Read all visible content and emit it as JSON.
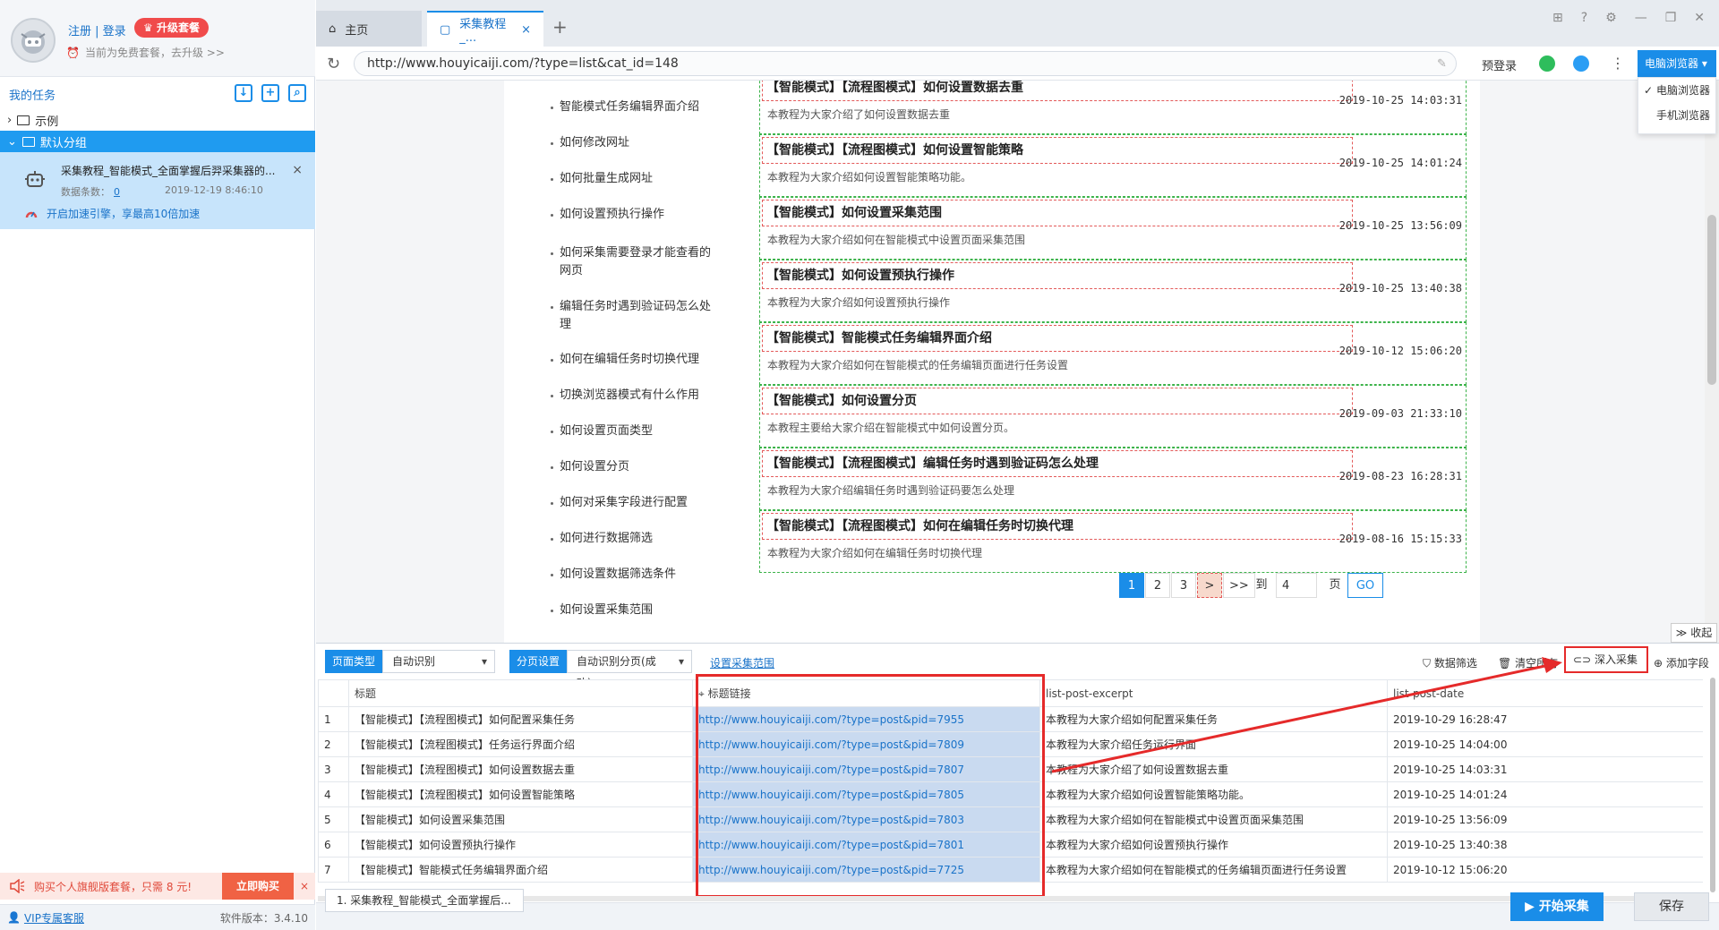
{
  "sidebar": {
    "login_link": "注册 | 登录",
    "upgrade_button": "升级套餐",
    "plan_text": "当前为免费套餐，去升级 >>",
    "my_tasks": "我的任务",
    "groups": [
      {
        "label": "示例"
      },
      {
        "label": "默认分组"
      }
    ],
    "task": {
      "title": "采集教程_智能模式_全面掌握后羿采集器的...",
      "count_label": "数据条数：",
      "count": "0",
      "time": "2019-12-19 8:46:10",
      "accel_text": "开启加速引擎，享最高10倍加速"
    },
    "promo": {
      "text": "购买个人旗舰版套餐，只需 8 元!",
      "buy": "立即购买"
    },
    "footer": {
      "vip": "VIP专属客服",
      "version": "软件版本：3.4.10"
    }
  },
  "browser": {
    "tabs": [
      {
        "label": "主页"
      },
      {
        "label": "采集教程_..."
      }
    ],
    "url": "http://www.houyicaiji.com/?type=list&cat_id=148",
    "prelogin": "预登录",
    "mode_button": "电脑浏览器",
    "mode_options": [
      "电脑浏览器",
      "手机浏览器"
    ]
  },
  "page": {
    "nav_items": [
      "智能模式任务编辑界面介绍",
      "如何修改网址",
      "如何批量生成网址",
      "如何设置预执行操作",
      "如何采集需要登录才能查看的网页",
      "编辑任务时遇到验证码怎么处理",
      "如何在编辑任务时切换代理",
      "切换浏览器模式有什么作用",
      "如何设置页面类型",
      "如何设置分页",
      "如何对采集字段进行配置",
      "如何进行数据筛选",
      "如何设置数据筛选条件",
      "如何设置采集范围"
    ],
    "posts": [
      {
        "title": "【智能模式】【流程图模式】如何设置数据去重",
        "date": "2019-10-25 14:03:31",
        "excerpt": "本教程为大家介绍了如何设置数据去重"
      },
      {
        "title": "【智能模式】【流程图模式】如何设置智能策略",
        "date": "2019-10-25 14:01:24",
        "excerpt": "本教程为大家介绍如何设置智能策略功能。"
      },
      {
        "title": "【智能模式】如何设置采集范围",
        "date": "2019-10-25 13:56:09",
        "excerpt": "本教程为大家介绍如何在智能模式中设置页面采集范围"
      },
      {
        "title": "【智能模式】如何设置预执行操作",
        "date": "2019-10-25 13:40:38",
        "excerpt": "本教程为大家介绍如何设置预执行操作"
      },
      {
        "title": "【智能模式】智能模式任务编辑界面介绍",
        "date": "2019-10-12 15:06:20",
        "excerpt": "本教程为大家介绍如何在智能模式的任务编辑页面进行任务设置"
      },
      {
        "title": "【智能模式】如何设置分页",
        "date": "2019-09-03 21:33:10",
        "excerpt": "本教程主要给大家介绍在智能模式中如何设置分页。"
      },
      {
        "title": "【智能模式】【流程图模式】编辑任务时遇到验证码怎么处理",
        "date": "2019-08-23 16:28:31",
        "excerpt": "本教程为大家介绍编辑任务时遇到验证码要怎么处理"
      },
      {
        "title": "【智能模式】【流程图模式】如何在编辑任务时切换代理",
        "date": "2019-08-16 15:15:33",
        "excerpt": "本教程为大家介绍如何在编辑任务时切换代理"
      }
    ],
    "pager": {
      "pages": [
        "1",
        "2",
        "3"
      ],
      "next": ">",
      "last": ">>",
      "goto_label": "到",
      "goto_value": "4",
      "page_unit": "页",
      "go": "GO"
    },
    "collapse": "收起"
  },
  "panel": {
    "page_type_label": "页面类型",
    "page_type_value": "自动识别",
    "paging_label": "分页设置",
    "paging_value": "自动识别分页(成功)",
    "scope_link": "设置采集范围",
    "tools": {
      "filter": "数据筛选",
      "clear": "清空所有",
      "deep": "深入采集",
      "add_field": "添加字段"
    },
    "columns": [
      "标题",
      "标题链接",
      "list-post-excerpt",
      "list-post-date"
    ],
    "rows": [
      [
        "1",
        "【智能模式】【流程图模式】如何配置采集任务",
        "http://www.houyicaiji.com/?type=post&pid=7955",
        "本教程为大家介绍如何配置采集任务",
        "2019-10-29 16:28:47"
      ],
      [
        "2",
        "【智能模式】【流程图模式】任务运行界面介绍",
        "http://www.houyicaiji.com/?type=post&pid=7809",
        "本教程为大家介绍任务运行界面",
        "2019-10-25 14:04:00"
      ],
      [
        "3",
        "【智能模式】【流程图模式】如何设置数据去重",
        "http://www.houyicaiji.com/?type=post&pid=7807",
        "本教程为大家介绍了如何设置数据去重",
        "2019-10-25 14:03:31"
      ],
      [
        "4",
        "【智能模式】【流程图模式】如何设置智能策略",
        "http://www.houyicaiji.com/?type=post&pid=7805",
        "本教程为大家介绍如何设置智能策略功能。",
        "2019-10-25 14:01:24"
      ],
      [
        "5",
        "【智能模式】如何设置采集范围",
        "http://www.houyicaiji.com/?type=post&pid=7803",
        "本教程为大家介绍如何在智能模式中设置页面采集范围",
        "2019-10-25 13:56:09"
      ],
      [
        "6",
        "【智能模式】如何设置预执行操作",
        "http://www.houyicaiji.com/?type=post&pid=7801",
        "本教程为大家介绍如何设置预执行操作",
        "2019-10-25 13:40:38"
      ],
      [
        "7",
        "【智能模式】智能模式任务编辑界面介绍",
        "http://www.houyicaiji.com/?type=post&pid=7725",
        "本教程为大家介绍如何在智能模式的任务编辑页面进行任务设置",
        "2019-10-12 15:06:20"
      ]
    ]
  },
  "footer": {
    "task_tab": "1. 采集教程_智能模式_全面掌握后...",
    "start": "开始采集",
    "save": "保存"
  },
  "colors": {
    "accent": "#1a8de8",
    "annotation_red": "#e52a2a",
    "selected_group": "#1f9bf0",
    "task_card": "#c7e4fb"
  }
}
